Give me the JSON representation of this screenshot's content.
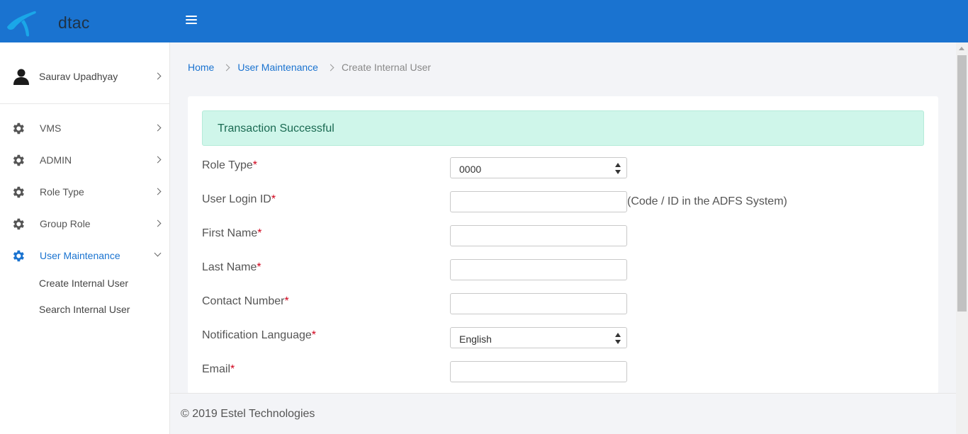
{
  "app": {
    "brand": "dtac"
  },
  "sidebar": {
    "user_name": "Saurav Upadhyay",
    "items": [
      {
        "label": "VMS"
      },
      {
        "label": "ADMIN"
      },
      {
        "label": "Role Type"
      },
      {
        "label": "Group Role"
      },
      {
        "label": "User Maintenance"
      }
    ],
    "subitems": [
      {
        "label": "Create Internal User"
      },
      {
        "label": "Search Internal User"
      }
    ]
  },
  "breadcrumb": {
    "home": "Home",
    "parent": "User Maintenance",
    "current": "Create Internal User"
  },
  "alert": {
    "message": "Transaction Successful"
  },
  "form": {
    "role_type": {
      "label": "Role Type",
      "value": "0000"
    },
    "user_login_id": {
      "label": "User Login ID",
      "value": "",
      "hint": "(Code / ID in the ADFS System)"
    },
    "first_name": {
      "label": "First Name",
      "value": ""
    },
    "last_name": {
      "label": "Last Name",
      "value": ""
    },
    "contact_number": {
      "label": "Contact Number",
      "value": ""
    },
    "notification_language": {
      "label": "Notification Language",
      "value": "English"
    },
    "email": {
      "label": "Email",
      "value": ""
    },
    "required_mark": "*"
  },
  "footer": {
    "text": "© 2019 Estel Technologies"
  },
  "colors": {
    "header": "#1a73d0",
    "accent": "#1a73d0",
    "alert_bg": "#cff6ea",
    "required": "#d0021b"
  },
  "icons": [
    "dtac-logo-icon",
    "hamburger-menu-icon",
    "user-avatar-icon",
    "gear-icon",
    "chevron-right-icon",
    "chevron-down-icon",
    "select-arrows-icon"
  ]
}
